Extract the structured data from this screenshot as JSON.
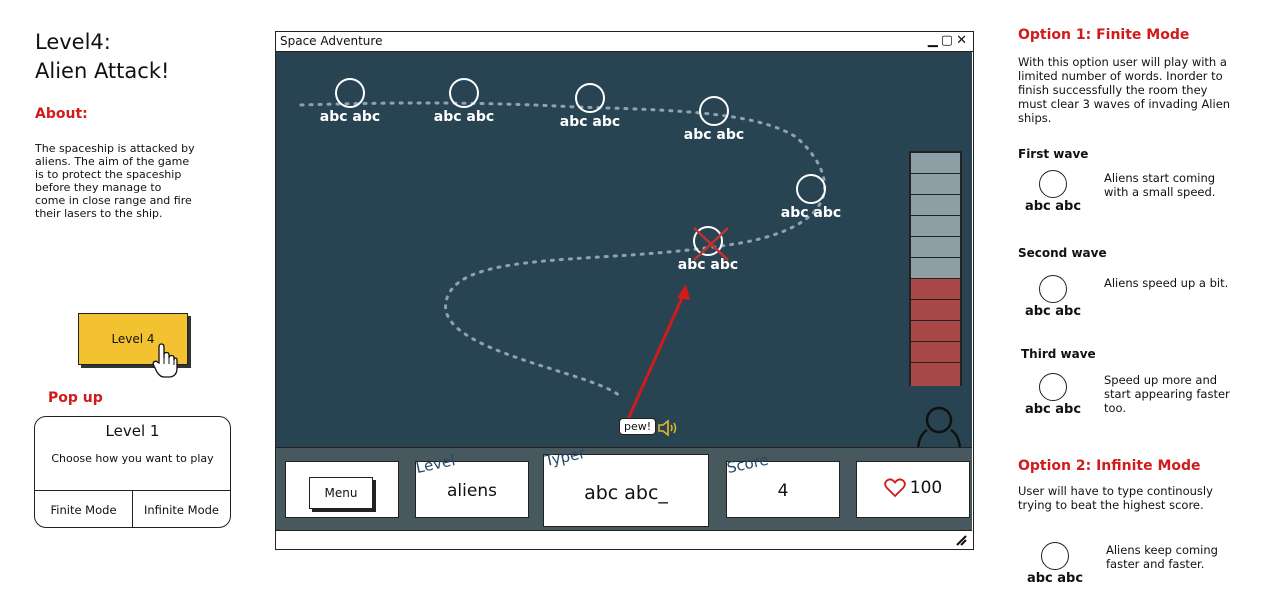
{
  "left": {
    "title_line1": "Level4:",
    "title_line2": "Alien Attack!",
    "about_heading": "About:",
    "about_text": "The spaceship is attacked by aliens. The aim of the game is to protect the spaceship before they manage to come in close range and fire their lasers to the ship.",
    "level_button": "Level 4",
    "popup_heading": "Pop up",
    "popup": {
      "title": "Level 1",
      "subtitle": "Choose how you want to play",
      "finite_button": "Finite Mode",
      "infinite_button": "Infinite Mode"
    }
  },
  "window": {
    "title": "Space Adventure",
    "controls": {
      "minimize": "▁",
      "maximize": "▢",
      "close": "✕"
    },
    "aliens": [
      "abc abc",
      "abc abc",
      "abc abc",
      "abc abc",
      "abc abc",
      "abc abc"
    ],
    "pew_label": "pew!",
    "health_bar": {
      "segments_total": 11,
      "segments_red": 5
    },
    "hud": {
      "menu_button": "Menu",
      "level_label": "Level",
      "level_value": "aliens",
      "typer_label": "Typer",
      "typer_value": "abc abc_",
      "score_label": "Score",
      "score_value": "4",
      "health_value": "100"
    }
  },
  "right": {
    "option1_heading": "Option 1: Finite Mode",
    "option1_text": "With this option user will play with a limited number of words. Inorder to finish successfully the room they must clear 3 waves of invading Alien ships.",
    "waves": [
      {
        "heading": "First wave",
        "label": "abc abc",
        "text": "Aliens start coming with a small speed."
      },
      {
        "heading": "Second wave",
        "label": "abc abc",
        "text": "Aliens speed up a bit."
      },
      {
        "heading": "Third wave",
        "label": "abc abc",
        "text": "Speed up more and start appearing faster too."
      }
    ],
    "option2_heading": "Option 2: Infinite Mode",
    "option2_text": "User will have to type continously trying to beat the highest score.",
    "infinite_alien": {
      "label": "abc abc",
      "text": "Aliens keep coming faster and faster."
    }
  },
  "colors": {
    "game_bg": "#284452",
    "hud_bg": "#47585f",
    "accent_red": "#d11a1a",
    "button_yellow": "#f2c230",
    "health_red": "#a84848",
    "health_grey": "#8e9ea5"
  }
}
